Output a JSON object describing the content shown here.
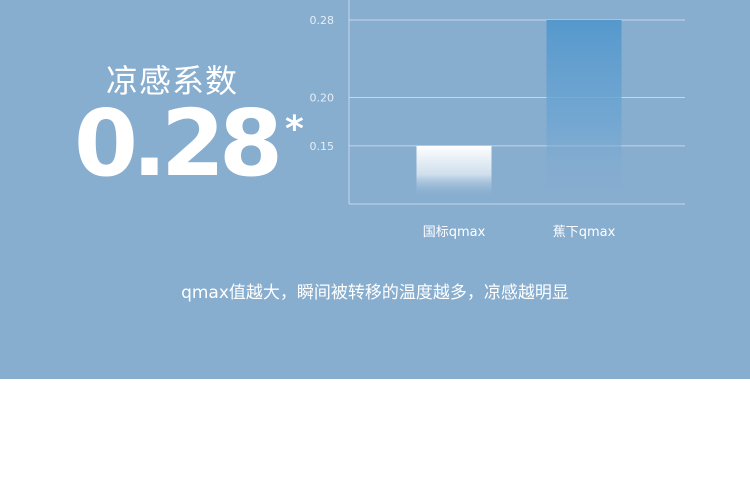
{
  "hero": {
    "label": "凉感系数",
    "value": "0.28",
    "footnote_mark": "*"
  },
  "caption": "qmax值越大，瞬间被转移的温度越多，凉感越明显",
  "colors": {
    "panel": "#87adcf",
    "bar_top_national": "#ffffff",
    "bar_top_jiaoxia": "#5598cc"
  },
  "chart_data": {
    "type": "bar",
    "categories": [
      "国标qmax",
      "蕉下qmax"
    ],
    "values": [
      0.15,
      0.28
    ],
    "y_ticks": [
      0.15,
      0.2,
      0.28
    ],
    "y_tick_labels": [
      "0.15",
      "0.20",
      "0.28"
    ],
    "title": "",
    "xlabel": "",
    "ylabel": "",
    "ylim": [
      0.09,
      0.28
    ],
    "grid": true
  }
}
